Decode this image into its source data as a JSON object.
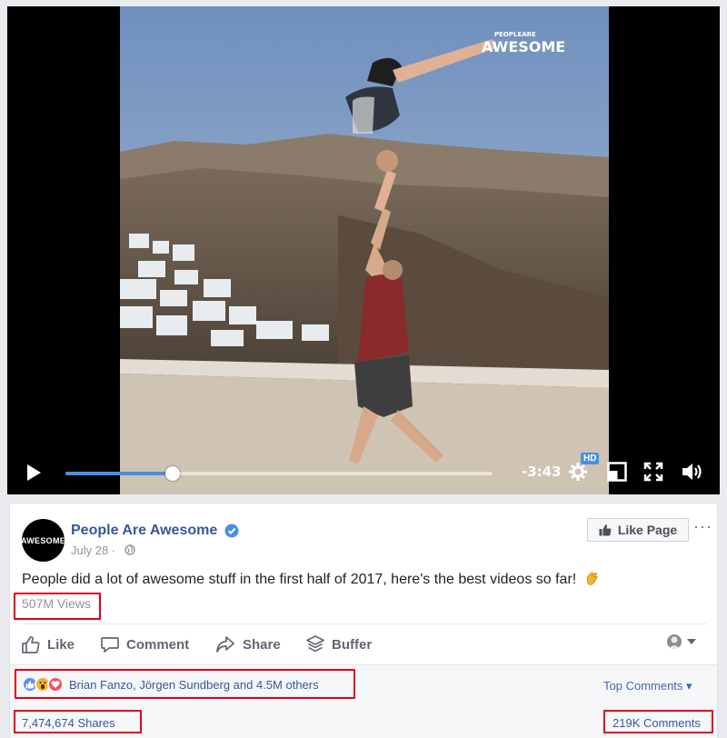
{
  "video": {
    "watermark_top": "PEOPLEARE",
    "watermark_main": "AWESOME",
    "time_remaining": "-3:43",
    "progress": 0.25,
    "hd_badge": "HD"
  },
  "post": {
    "page_name": "People Are Awesome",
    "avatar_text": "AWESOME",
    "date": "July 28 ·",
    "like_page_label": "Like Page",
    "more_label": "···",
    "text": "People did a lot of awesome stuff in the first half of 2017, here's the best videos so far!",
    "views": "507M Views"
  },
  "actions": {
    "like": "Like",
    "comment": "Comment",
    "share": "Share",
    "buffer": "Buffer"
  },
  "feedback": {
    "reactors": "Brian Fanzo, Jörgen Sundberg and 4.5M others",
    "top_comments": "Top Comments ▾",
    "shares": "7,474,674 Shares",
    "comments": "219K Comments"
  },
  "colors": {
    "link": "#365899",
    "highlight": "#e1001a",
    "progress": "#4a90e2"
  }
}
